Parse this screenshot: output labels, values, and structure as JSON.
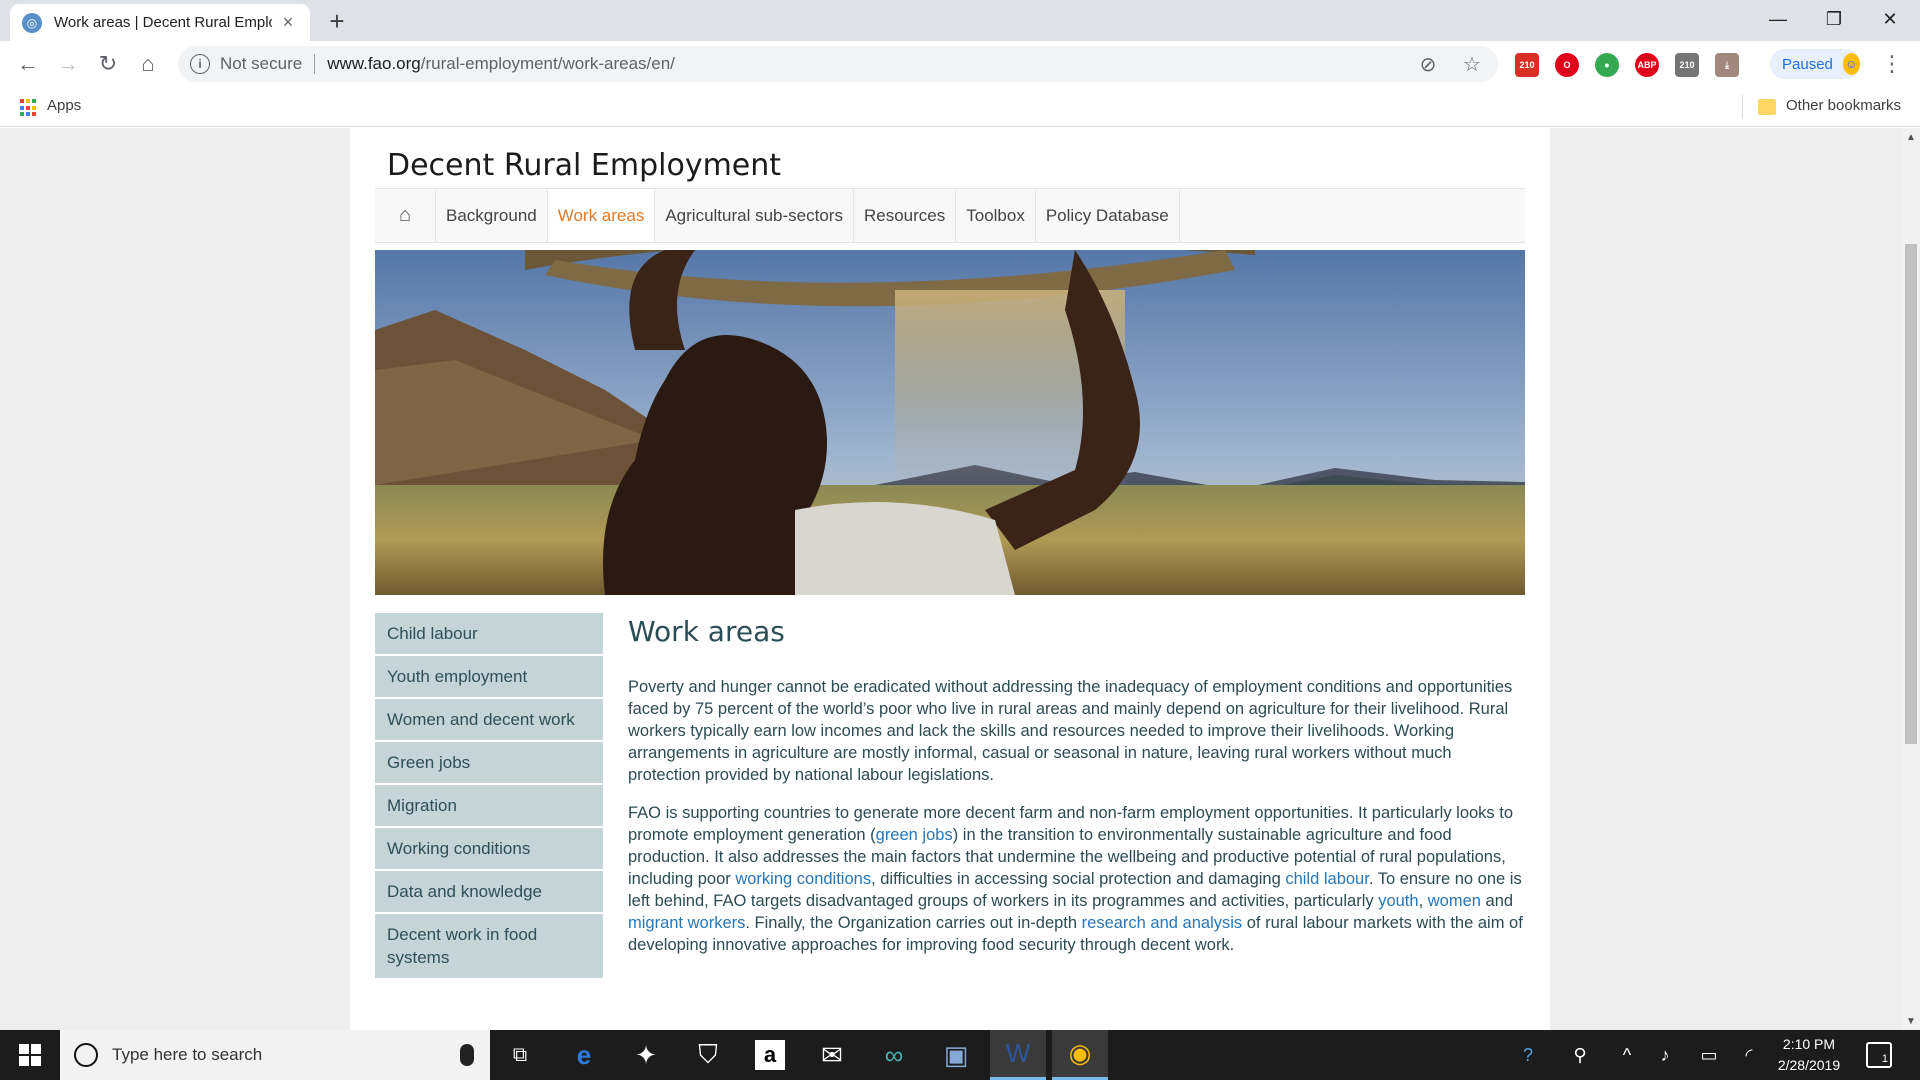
{
  "browser": {
    "tab": {
      "title": "Work areas | Decent Rural Emplo",
      "favicon": "fao-globe-icon"
    },
    "new_tab_symbol": "+",
    "window_controls": [
      "—",
      "❐",
      "✕"
    ],
    "address": {
      "security_label": "Not secure",
      "host": "www.fao.org",
      "path": "/rural-employment/work-areas/en/"
    },
    "extensions": [
      {
        "name": "gmail-icon",
        "badge": "210",
        "color": "#d93025"
      },
      {
        "name": "opera-icon",
        "badge": "",
        "color": "#e0001b"
      },
      {
        "name": "globe-extension-icon",
        "badge": "",
        "color": "#34a853"
      },
      {
        "name": "adblock-plus-icon",
        "badge": "ABP",
        "color": "#e0001b"
      },
      {
        "name": "gmail-checker-icon",
        "badge": "210",
        "color": "#757575"
      },
      {
        "name": "pdf-icon",
        "badge": "",
        "color": "#a1887f"
      }
    ],
    "profile": {
      "label": "Paused"
    },
    "bookmarks": {
      "apps_label": "Apps",
      "other_label": "Other bookmarks"
    }
  },
  "site": {
    "title": "Decent Rural Employment",
    "nav": [
      {
        "label": "Background",
        "active": false
      },
      {
        "label": "Work areas",
        "active": true
      },
      {
        "label": "Agricultural sub-sectors",
        "active": false
      },
      {
        "label": "Resources",
        "active": false
      },
      {
        "label": "Toolbox",
        "active": false
      },
      {
        "label": "Policy Database",
        "active": false
      }
    ],
    "sidebar": [
      {
        "label": "Child labour"
      },
      {
        "label": "Youth employment"
      },
      {
        "label": "Women and decent work"
      },
      {
        "label": "Green jobs"
      },
      {
        "label": "Migration"
      },
      {
        "label": "Working conditions"
      },
      {
        "label": "Data and knowledge"
      },
      {
        "label": "Decent work in food systems"
      }
    ],
    "content": {
      "heading": "Work areas",
      "p1": "Poverty and hunger cannot be eradicated without addressing the inadequacy of employment conditions and opportunities faced by 75 percent of the world’s poor who live in rural areas and mainly depend on agriculture for their livelihood. Rural workers typically earn low incomes and lack the skills and resources needed to improve their livelihoods. Working arrangements in agriculture are mostly informal, casual or seasonal in nature, leaving rural workers without much protection provided by national labour legislations.",
      "p2": {
        "t1": "FAO is supporting countries to generate more decent farm and non-farm employment opportunities. It particularly looks to promote employment generation (",
        "l1": "green jobs",
        "t2": ") in the transition to environmentally sustainable agriculture and food production. It also addresses the main factors that undermine the wellbeing and productive potential of rural populations, including poor ",
        "l2": "working conditions",
        "t3": ", difficulties in accessing social protection and damaging ",
        "l3": "child labour",
        "t4": ". To ensure no one is left behind, FAO targets disadvantaged groups of workers in its programmes and activities, particularly ",
        "l4": "youth",
        "t5": ", ",
        "l5": "women",
        "t6": " and ",
        "l6": "migrant workers",
        "t7": ". Finally, the Organization carries out in-depth ",
        "l7": "research and analysis",
        "t8": " of rural labour markets with the aim of developing innovative approaches for improving food security through decent work."
      }
    }
  },
  "taskbar": {
    "search_placeholder": "Type here to search",
    "apps": [
      "task-view-icon",
      "edge-icon",
      "dropbox-icon",
      "store-icon",
      "amazon-icon",
      "mail-icon",
      "infinity-icon",
      "control-panel-icon",
      "word-icon",
      "chrome-icon"
    ],
    "clock": {
      "time": "2:10 PM",
      "date": "2/28/2019"
    },
    "notification_count": "1"
  },
  "colors": {
    "accent_orange": "#e07a26",
    "sidebar_bg": "#c5d4d7",
    "link_blue": "#2776b7",
    "heading_teal": "#2b4d56"
  }
}
